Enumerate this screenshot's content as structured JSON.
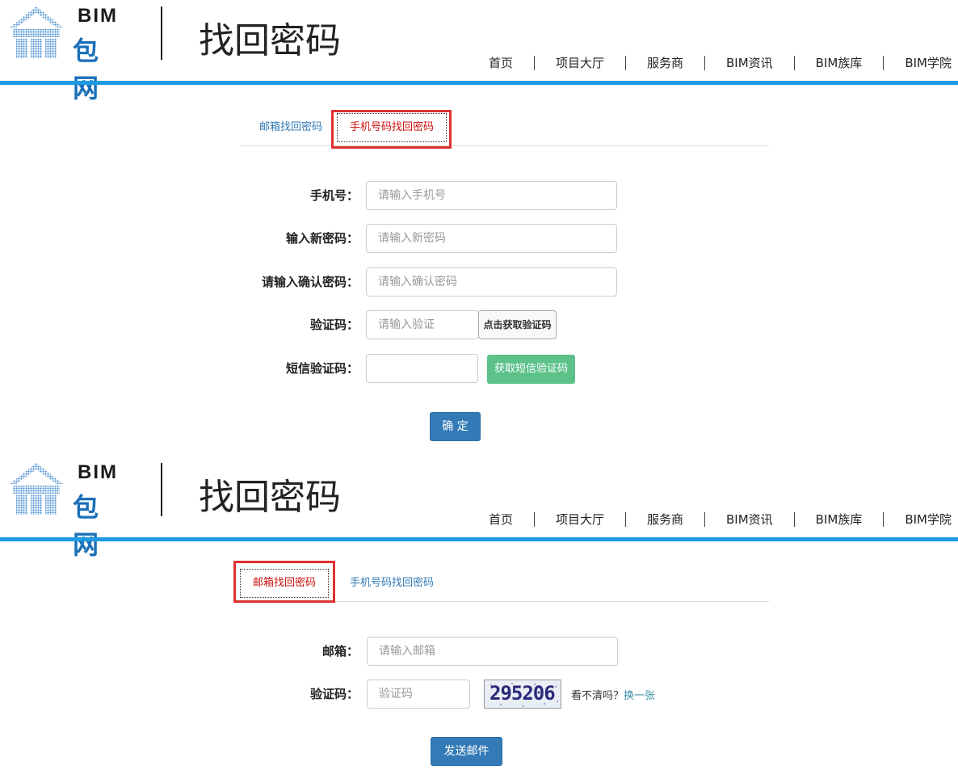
{
  "header": {
    "logo_bim": "BIM",
    "logo_bao": "包网",
    "title": "找回密码",
    "nav": [
      "首页",
      "项目大厅",
      "服务商",
      "BIM资讯",
      "BIM族库",
      "BIM学院"
    ]
  },
  "tabs": {
    "email": "邮箱找回密码",
    "phone": "手机号码找回密码"
  },
  "phone_form": {
    "phone_label": "手机号：",
    "phone_placeholder": "请输入手机号",
    "newpwd_label": "输入新密码：",
    "newpwd_placeholder": "请输入新密码",
    "confirm_label": "请输入确认密码：",
    "confirm_placeholder": "请输入确认密码",
    "code_label": "验证码：",
    "code_placeholder": "请输入验证",
    "get_code_button": "点击获取验证码",
    "sms_label": "短信验证码：",
    "sms_placeholder": "",
    "get_sms_button": "获取短信验证码",
    "submit": "确 定"
  },
  "email_form": {
    "email_label": "邮箱：",
    "email_placeholder": "请输入邮箱",
    "code_label": "验证码：",
    "code_placeholder": "验证码",
    "captcha_text": "295206",
    "hint_text": "看不清吗？",
    "hint_link": "换一张",
    "submit": "发送邮件"
  },
  "colors": {
    "accent_blue": "#1e9be0",
    "tab_active_red": "#cc1111",
    "highlight_red": "#e03030",
    "button_blue": "#337ab7",
    "button_green": "#5cc28a"
  }
}
